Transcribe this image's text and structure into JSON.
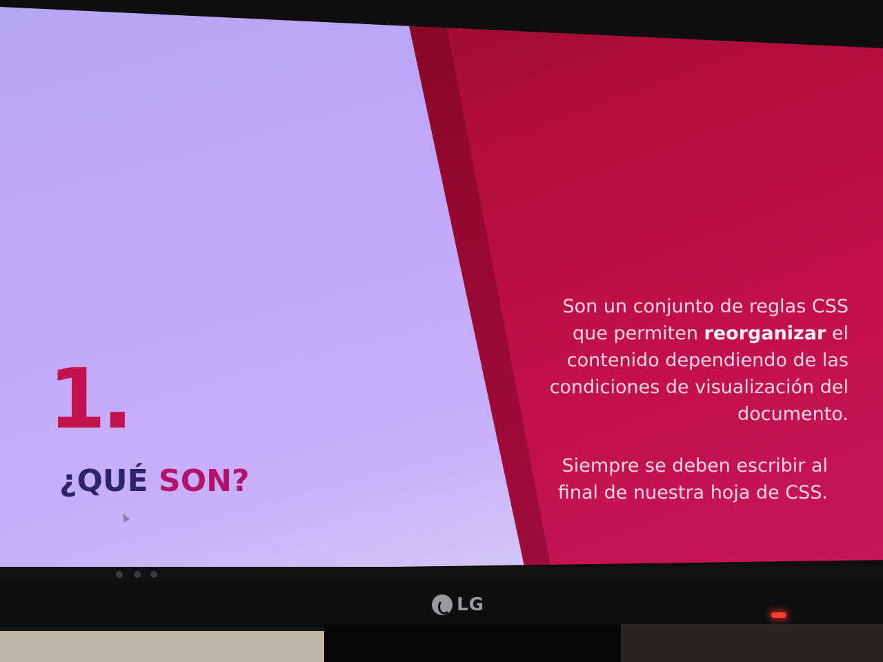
{
  "slide": {
    "number": "1.",
    "heading_part1": "¿QUÉ ",
    "heading_part2": "SON?",
    "paragraph1_before": "Son un conjunto de reglas CSS que permiten ",
    "paragraph1_strong": "reorganizar",
    "paragraph1_after": " el contenido dependiendo de las condiciones de visualización del documento.",
    "paragraph2": "Siempre se deben escribir al final de nuestra hoja de CSS."
  },
  "monitor": {
    "brand": "LG"
  },
  "colors": {
    "left_panel": "#c3a7fb",
    "right_panel": "#c2104b",
    "number": "#c2124f",
    "heading_dark": "#2c2466",
    "heading_accent": "#b3116a",
    "body_text": "#f2d7e4"
  }
}
